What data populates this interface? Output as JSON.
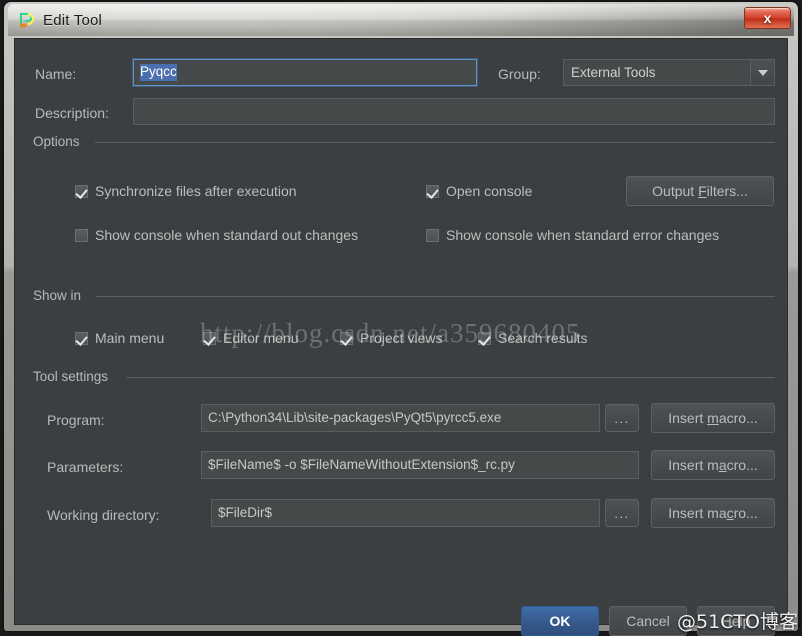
{
  "window": {
    "title": "Edit Tool",
    "app_icon": "pycharm-icon",
    "close_label": "x",
    "accent_color": "#4b6eaf",
    "dialog_bg": "#3c3f41"
  },
  "fields": {
    "name_label": "Name:",
    "name_value": "Pyqcc",
    "name_focused": true,
    "description_label": "Description:",
    "description_value": "",
    "group_label": "Group:",
    "group_value": "External Tools",
    "group_options": [
      "External Tools"
    ]
  },
  "options": {
    "group_title": "Options",
    "checkboxes": [
      {
        "label": "Synchronize files after execution",
        "checked": true
      },
      {
        "label": "Open console",
        "checked": true
      },
      {
        "label": "Show console when standard out changes",
        "checked": false
      },
      {
        "label": "Show console when standard error changes",
        "checked": false
      }
    ],
    "output_filters_button": "Output Filters...",
    "output_filters_mnemonic": "F"
  },
  "show_in": {
    "group_title": "Show in",
    "checkboxes": [
      {
        "label": "Main menu",
        "checked": true
      },
      {
        "label": "Editor menu",
        "checked": true
      },
      {
        "label": "Project views",
        "checked": true
      },
      {
        "label": "Search results",
        "checked": true
      }
    ]
  },
  "tool_settings": {
    "group_title": "Tool settings",
    "rows": [
      {
        "label": "Program:",
        "value": "C:\\Python34\\Lib\\site-packages\\PyQt5\\pyrcc5.exe",
        "browse": "...",
        "macro_button": "Insert macro...",
        "macro_mnemonic": "m"
      },
      {
        "label": "Parameters:",
        "value": "$FileName$ -o $FileNameWithoutExtension$_rc.py",
        "browse": null,
        "macro_button": "Insert macro...",
        "macro_mnemonic": "a"
      },
      {
        "label": "Working directory:",
        "value": "$FileDir$",
        "browse": "...",
        "macro_button": "Insert macro...",
        "macro_mnemonic": "c"
      }
    ]
  },
  "footer": {
    "ok_label": "OK",
    "cancel_label": "Cancel",
    "help_label": "Help"
  },
  "watermarks": {
    "center": "http://blog.csdn.net/a359680405",
    "bottom_right": "@51CTO博客"
  }
}
